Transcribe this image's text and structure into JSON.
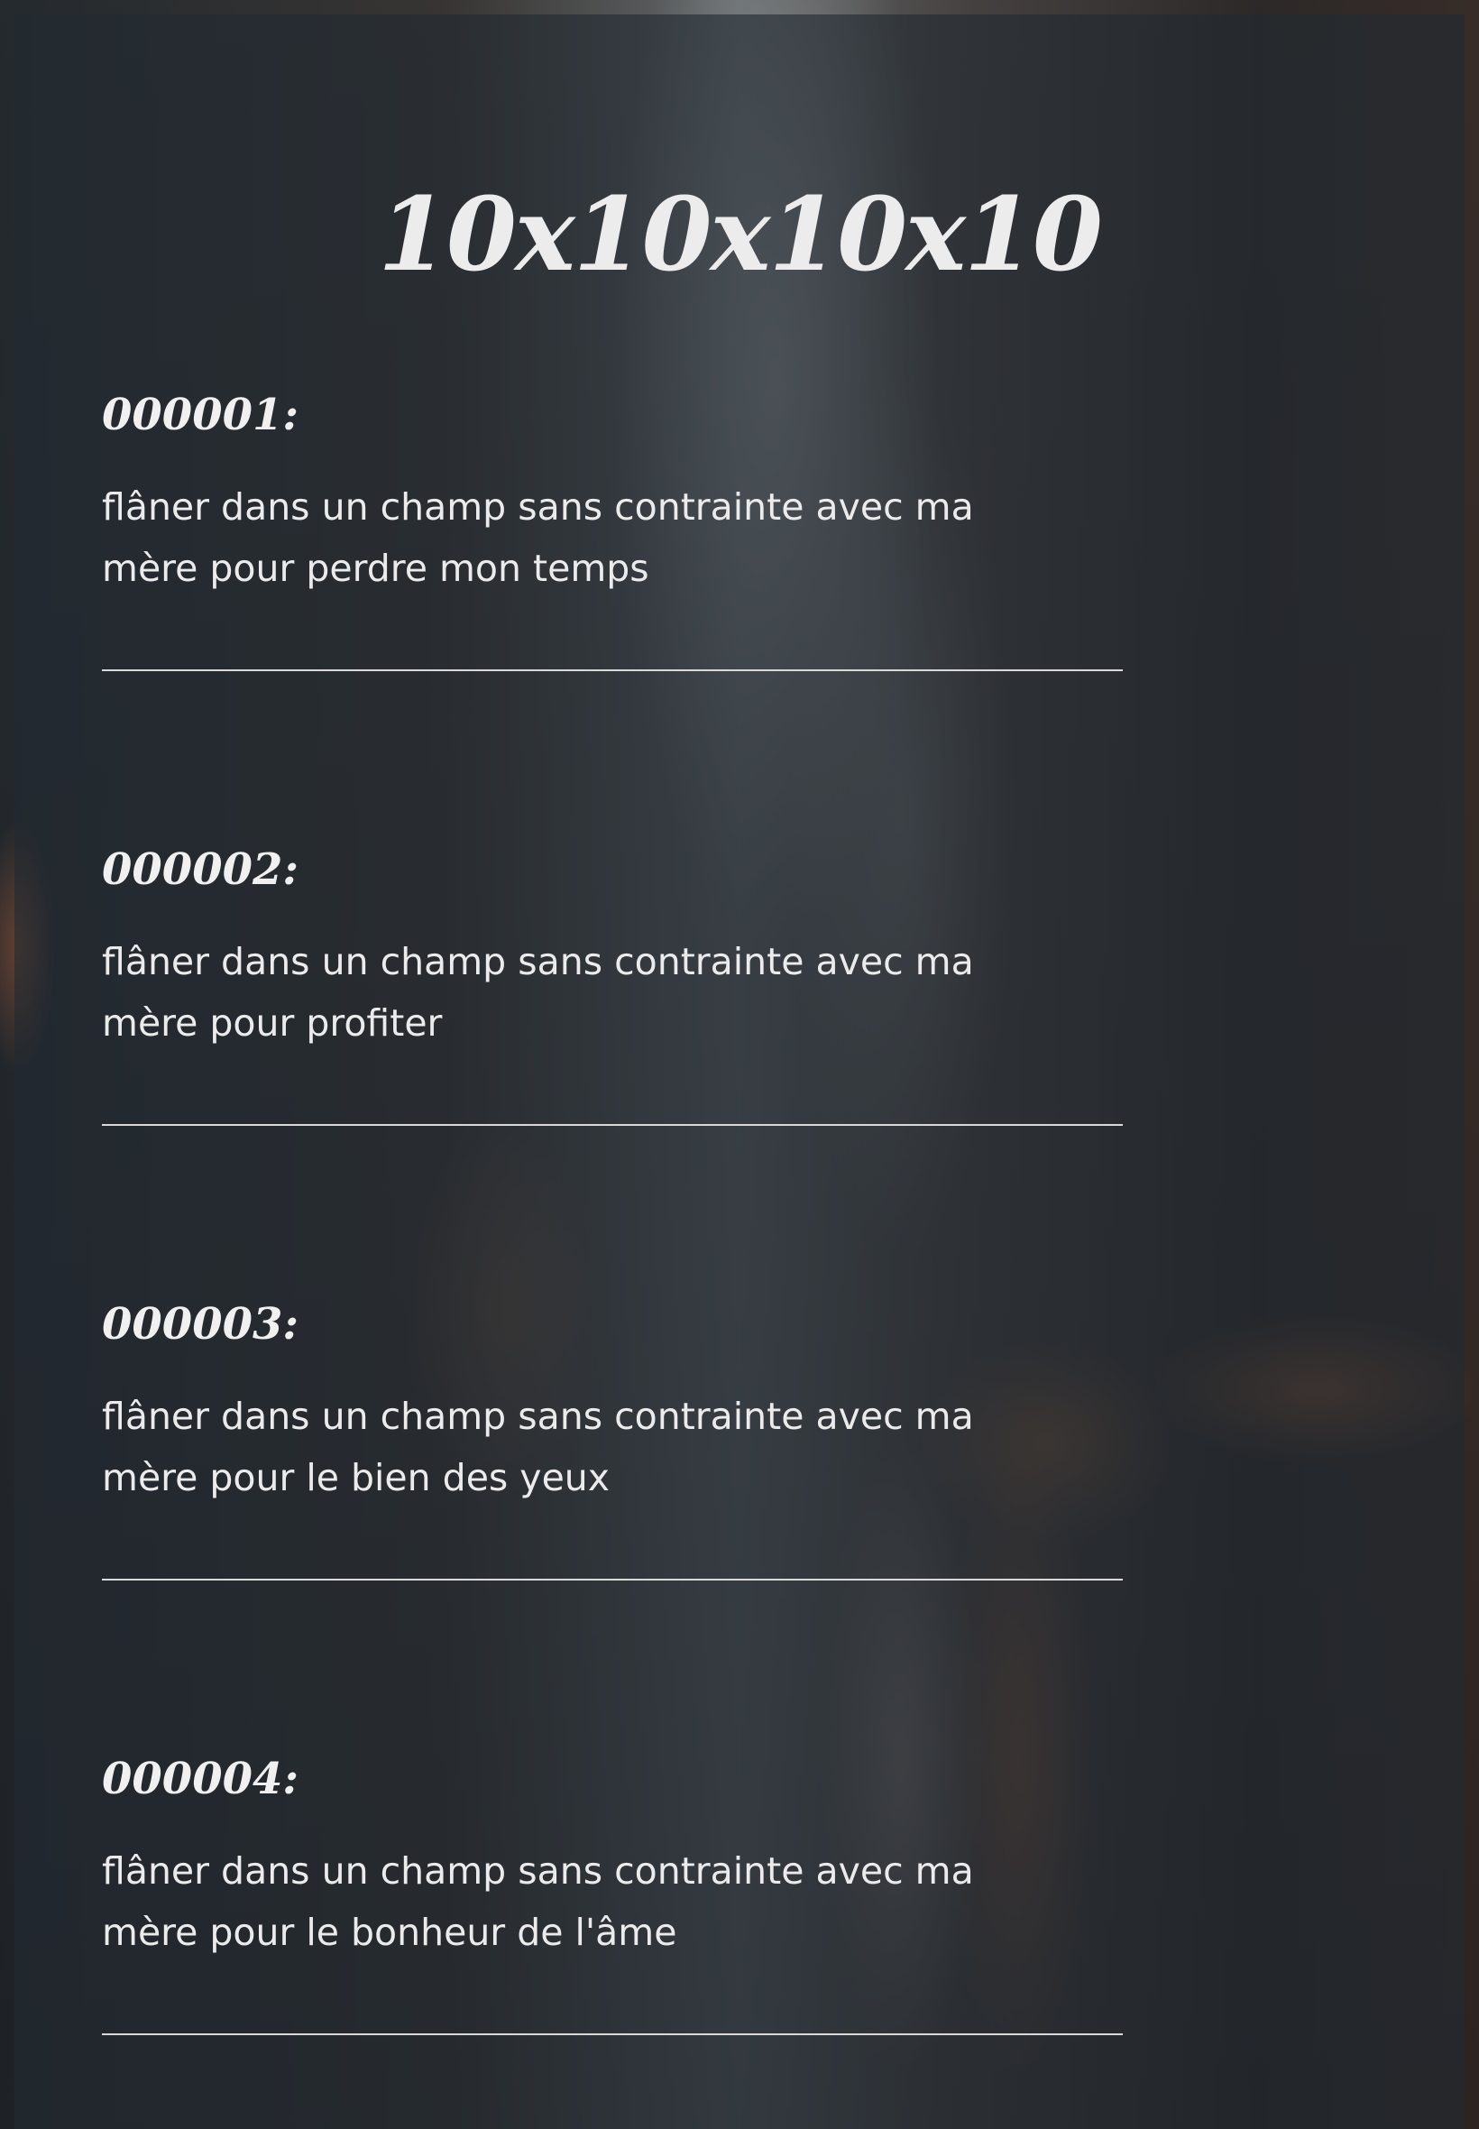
{
  "page": {
    "title": "10x10x10x10"
  },
  "entries": [
    {
      "number": "000001:",
      "text": "flâner dans un champ sans contrainte avec ma mère pour perdre mon temps"
    },
    {
      "number": "000002:",
      "text": "flâner dans un champ sans contrainte avec ma mère pour profiter"
    },
    {
      "number": "000003:",
      "text": "flâner dans un champ sans contrainte avec ma mère pour le bien des yeux"
    },
    {
      "number": "000004:",
      "text": "flâner dans un champ sans contrainte avec ma mère pour le bonheur de l'âme"
    }
  ]
}
